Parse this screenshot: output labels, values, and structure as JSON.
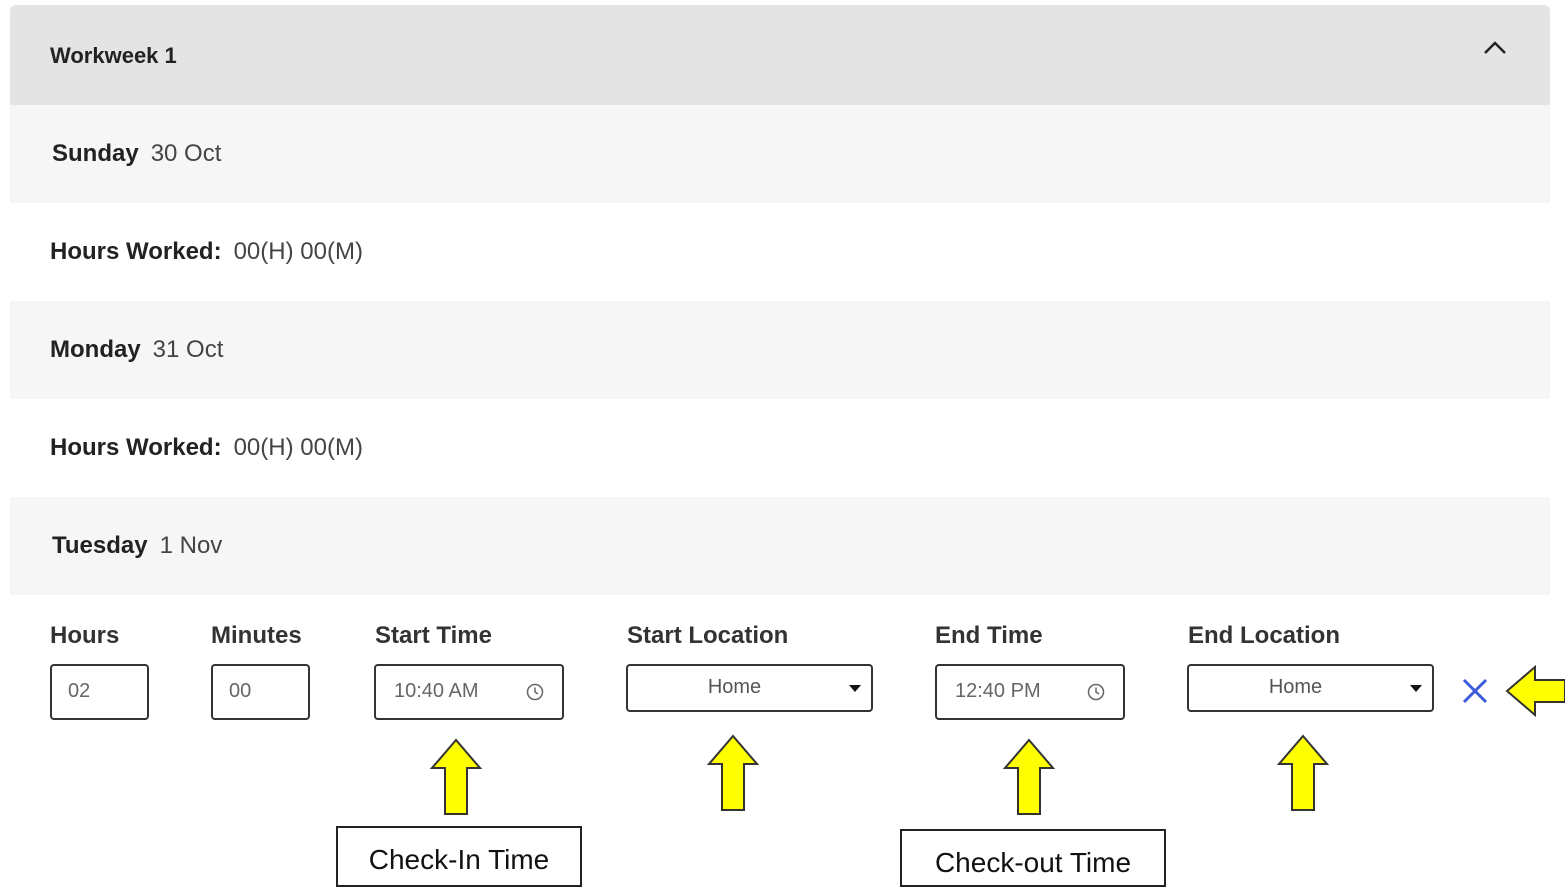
{
  "panel": {
    "title": "Workweek 1",
    "collapse_icon": "chevron-up-icon"
  },
  "rows": [
    {
      "label": "Sunday",
      "value": "30 Oct"
    },
    {
      "label": "Hours Worked:",
      "value": "00(H) 00(M)"
    },
    {
      "label": "Monday",
      "value": "31 Oct"
    },
    {
      "label": "Hours Worked:",
      "value": "00(H) 00(M)"
    },
    {
      "label": "Tuesday",
      "value": "1 Nov"
    }
  ],
  "entry": {
    "hours_label": "Hours",
    "hours_value": "02",
    "minutes_label": "Minutes",
    "minutes_value": "00",
    "start_time_label": "Start Time",
    "start_time_value": "10:40 AM",
    "start_location_label": "Start Location",
    "start_location_value": "Home",
    "end_time_label": "End Time",
    "end_time_value": "12:40 PM",
    "end_location_label": "End Location",
    "end_location_value": "Home",
    "remove_icon": "close-icon",
    "clock_icon": "clock-icon"
  },
  "annotations": {
    "check_in": "Check-In Time",
    "check_out": "Check-out Time",
    "arrow_color": "#ffff00",
    "accent_color": "#3b5bdb"
  }
}
